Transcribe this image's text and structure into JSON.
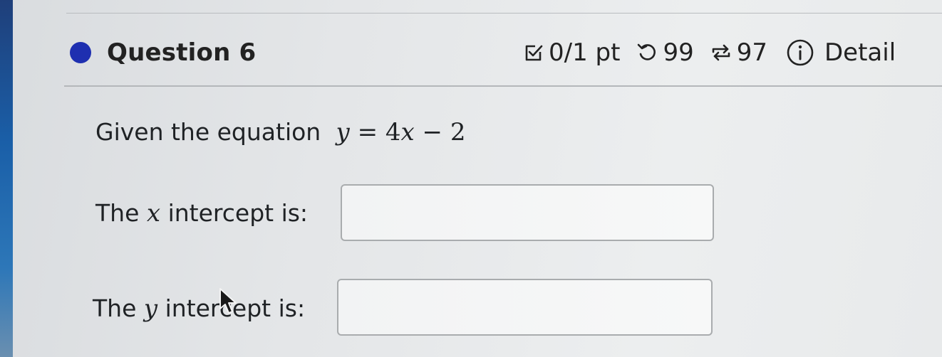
{
  "question": {
    "title": "Question 6",
    "status_color": "#1e2fb0"
  },
  "meta": {
    "points": "0/1 pt",
    "retries": "99",
    "attempts": "97",
    "details_label": "Detail"
  },
  "icons": {
    "points": "checkbox-check-icon",
    "retries": "undo-icon",
    "attempts": "repeat-icon",
    "details": "info-icon"
  },
  "prompt": {
    "lead": "Given the equation",
    "equation": {
      "lhs": "y",
      "op": "=",
      "coef": "4",
      "var": "x",
      "minus": "−",
      "const": "2"
    }
  },
  "x_intercept": {
    "prefix": "The",
    "var": "x",
    "suffix": "intercept is:",
    "value": ""
  },
  "y_intercept": {
    "prefix": "The",
    "var": "y",
    "suffix": "intercept is:",
    "value": ""
  }
}
